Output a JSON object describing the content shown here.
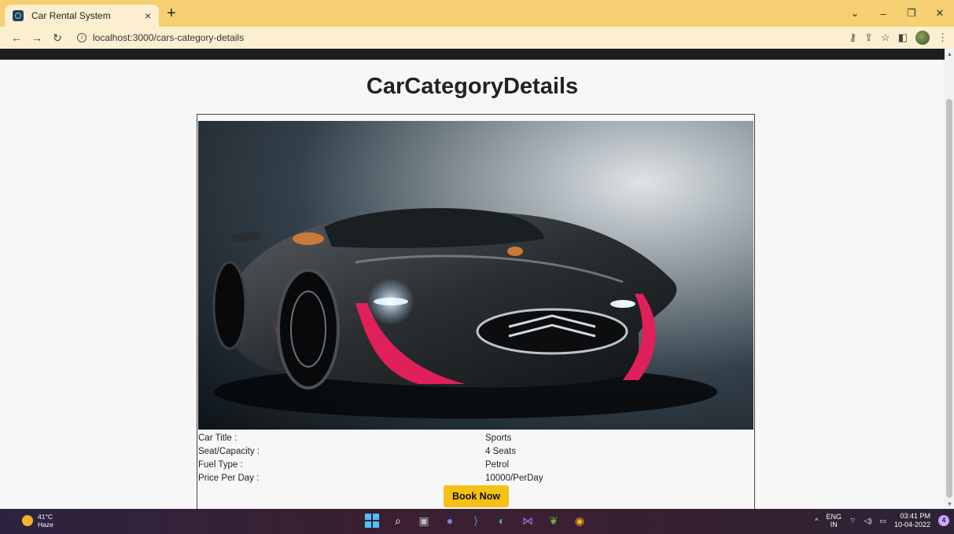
{
  "browser": {
    "tab_title": "Car Rental System",
    "tab_close": "×",
    "new_tab": "+",
    "url": "localhost:3000/cars-category-details",
    "window_controls": [
      "⌄",
      "–",
      "❐",
      "✕"
    ]
  },
  "page": {
    "title": "CarCategoryDetails",
    "details": [
      {
        "label": "Car Title :",
        "value": "Sports"
      },
      {
        "label": "Seat/Capacity :",
        "value": "4 Seats"
      },
      {
        "label": "Fuel Type :",
        "value": "Petrol"
      },
      {
        "label": "Price Per Day :",
        "value": "10000/PerDay"
      }
    ],
    "book_button": "Book Now"
  },
  "taskbar": {
    "temperature": "41°C",
    "weather": "Haze",
    "lang_primary": "ENG",
    "lang_region": "IN",
    "time": "03:41 PM",
    "date": "10-04-2022",
    "notification_count": "4"
  },
  "colors": {
    "tabbar": "#f5cf72",
    "toolbar": "#fbefd0",
    "accent_button": "#f6c015",
    "car_accent": "#e0205a"
  }
}
